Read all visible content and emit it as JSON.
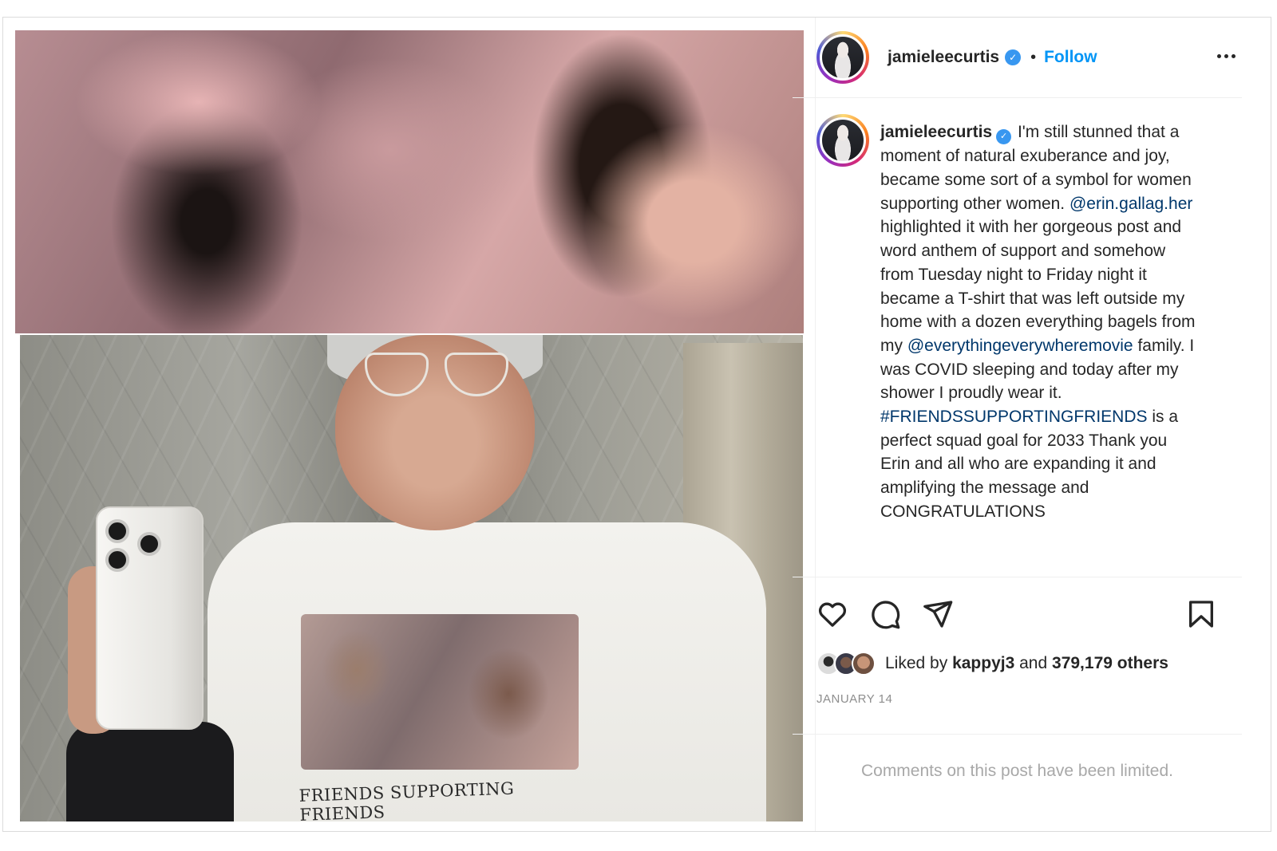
{
  "post": {
    "username": "jamieleecurtis",
    "follow_label": "Follow",
    "separator": "•",
    "verified_mark": "✓",
    "caption": {
      "username": "jamieleecurtis",
      "part1": "I'm still stunned that a moment of natural exuberance and joy, became some sort of a symbol for women supporting other women. ",
      "mention1": "@erin.gallag.her",
      "part2": " highlighted it with her gorgeous post and word anthem of support and somehow from Tuesday night to Friday night it became a T-shirt that was left outside my home with a dozen everything bagels from my ",
      "mention2": "@everythingeverywheremovie",
      "part3": " family. I was COVID sleeping and today after my shower I proudly wear it. ",
      "hashtag": "#FRIENDSSUPPORTINGFRIENDS",
      "part4": " is a perfect squad goal for 2033 Thank you Erin and all who are expanding it and amplifying the message and CONGRATULATIONS"
    },
    "likes": {
      "prefix": "Liked by",
      "liker": "kappyj3",
      "conjunction": "and",
      "others": "379,179 others"
    },
    "date": "JANUARY 14",
    "comments_notice": "Comments on this post have been limited.",
    "shirt_caption": "FRIENDS SUPPORTING FRIENDS"
  },
  "icons": {
    "header": [
      "avatar",
      "verified-icon",
      "more-icon"
    ],
    "actions": [
      "heart-icon",
      "comment-icon",
      "share-icon",
      "bookmark-icon"
    ]
  },
  "colors": {
    "link_blue": "#0095f6",
    "mention_blue": "#00376b",
    "verified_blue": "#3897f0",
    "muted_gray": "#8e8e8e"
  }
}
